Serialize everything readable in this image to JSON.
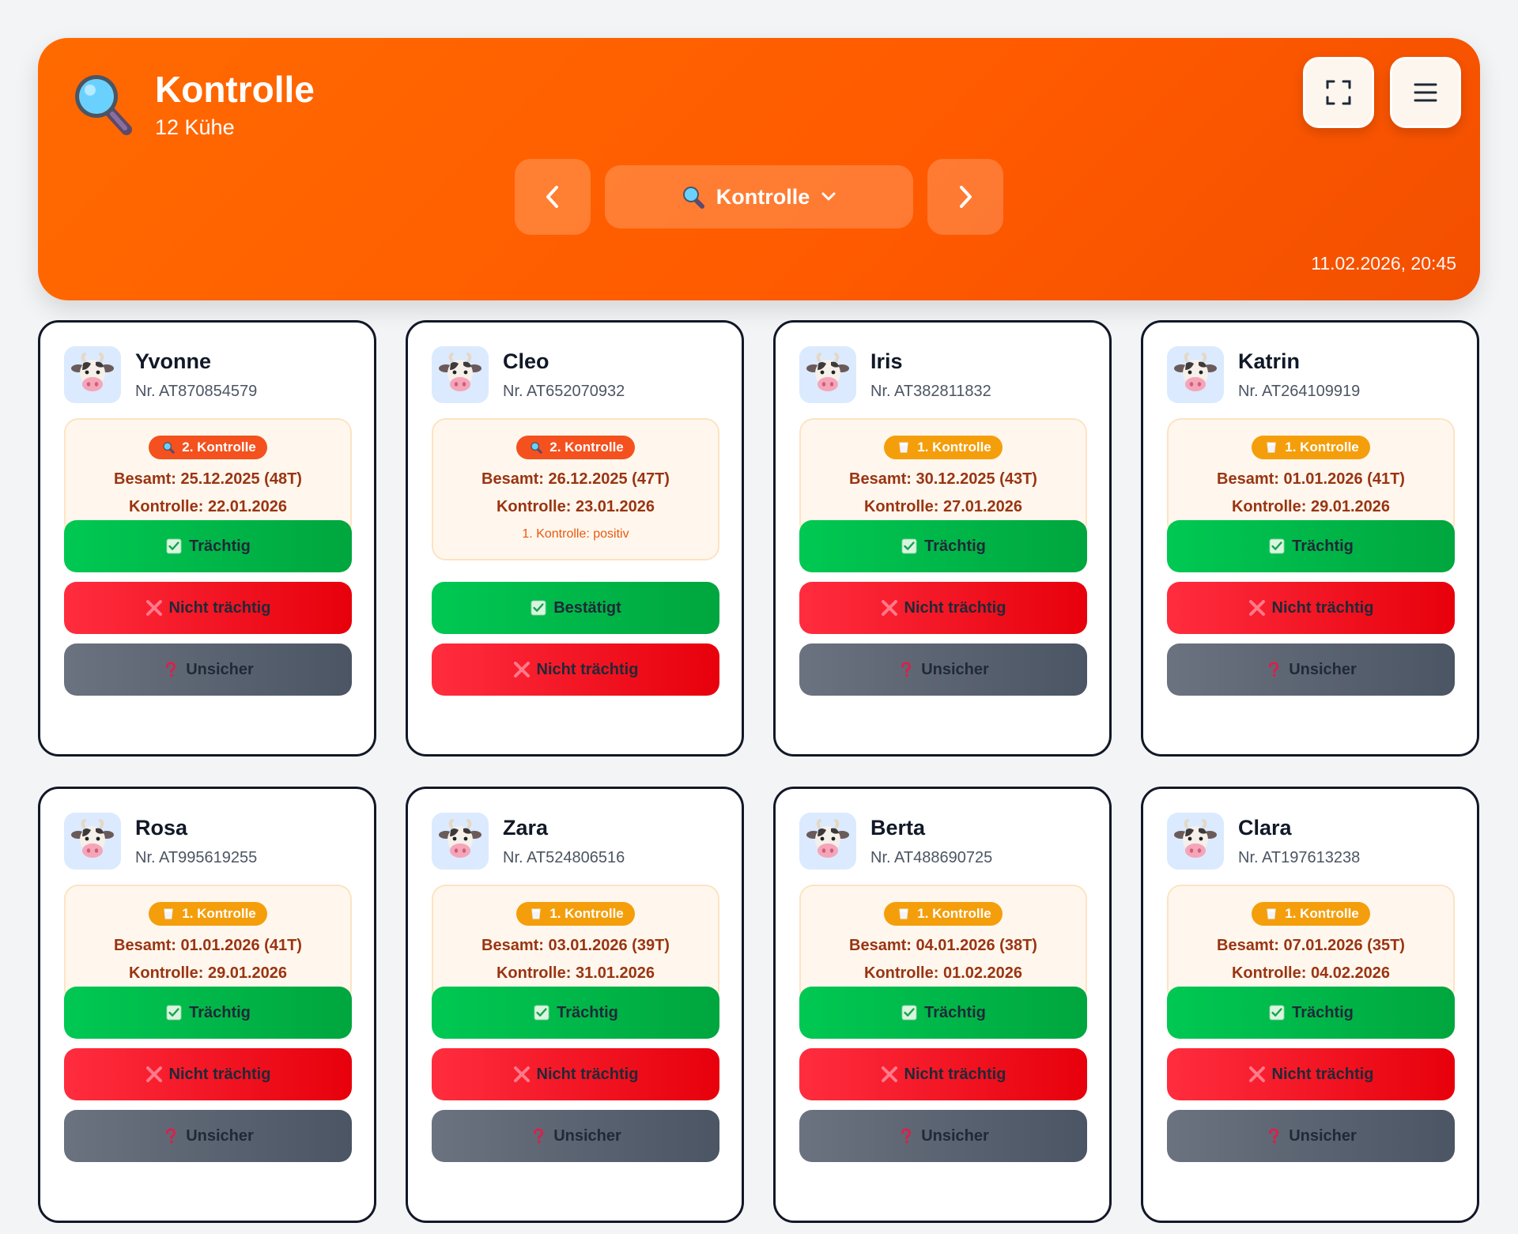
{
  "header": {
    "title": "Kontrolle",
    "subtitle": "12 Kühe",
    "nav_select_label": "Kontrolle",
    "datetime": "11.02.2026, 20:45",
    "brand_color": "#ff6a00"
  },
  "icons": {
    "header": "magnifying-glass-icon",
    "fullscreen": "fullscreen-icon",
    "menu": "hamburger-menu-icon",
    "prev": "chevron-left-icon",
    "next": "chevron-right-icon",
    "dropdown": "chevron-down-icon",
    "avatar": "cow-face-icon",
    "badge_k2": "magnifying-glass-icon",
    "badge_k1": "milk-glass-icon",
    "confirm": "check-box-icon",
    "reject": "cross-mark-icon",
    "unsure": "question-mark-icon"
  },
  "colors": {
    "green": "#00c853",
    "red": "#ff2d3f",
    "gray": "#6b7280",
    "badge_k2": "#f4511e",
    "badge_k1": "#f59e0b"
  },
  "cows": [
    {
      "name": "Yvonne",
      "nr": "Nr. AT870854579",
      "badge": "2. Kontrolle",
      "badge_type": "k2",
      "besamt": "Besamt: 25.12.2025 (48T)",
      "kontrolle": "Kontrolle: 22.01.2026",
      "note": "",
      "actions": [
        {
          "label": "Trächtig",
          "type": "green"
        },
        {
          "label": "Nicht trächtig",
          "type": "red"
        },
        {
          "label": "Unsicher",
          "type": "gray"
        }
      ]
    },
    {
      "name": "Cleo",
      "nr": "Nr. AT652070932",
      "badge": "2. Kontrolle",
      "badge_type": "k2",
      "besamt": "Besamt: 26.12.2025 (47T)",
      "kontrolle": "Kontrolle: 23.01.2026",
      "note": "1. Kontrolle: positiv",
      "actions": [
        {
          "label": "Bestätigt",
          "type": "green"
        },
        {
          "label": "Nicht trächtig",
          "type": "red"
        }
      ]
    },
    {
      "name": "Iris",
      "nr": "Nr. AT382811832",
      "badge": "1. Kontrolle",
      "badge_type": "k1",
      "besamt": "Besamt: 30.12.2025 (43T)",
      "kontrolle": "Kontrolle: 27.01.2026",
      "note": "",
      "actions": [
        {
          "label": "Trächtig",
          "type": "green"
        },
        {
          "label": "Nicht trächtig",
          "type": "red"
        },
        {
          "label": "Unsicher",
          "type": "gray"
        }
      ]
    },
    {
      "name": "Katrin",
      "nr": "Nr. AT264109919",
      "badge": "1. Kontrolle",
      "badge_type": "k1",
      "besamt": "Besamt: 01.01.2026 (41T)",
      "kontrolle": "Kontrolle: 29.01.2026",
      "note": "",
      "actions": [
        {
          "label": "Trächtig",
          "type": "green"
        },
        {
          "label": "Nicht trächtig",
          "type": "red"
        },
        {
          "label": "Unsicher",
          "type": "gray"
        }
      ]
    },
    {
      "name": "Rosa",
      "nr": "Nr. AT995619255",
      "badge": "1. Kontrolle",
      "badge_type": "k1",
      "besamt": "Besamt: 01.01.2026 (41T)",
      "kontrolle": "Kontrolle: 29.01.2026",
      "note": "",
      "actions": [
        {
          "label": "Trächtig",
          "type": "green"
        },
        {
          "label": "Nicht trächtig",
          "type": "red"
        },
        {
          "label": "Unsicher",
          "type": "gray"
        }
      ]
    },
    {
      "name": "Zara",
      "nr": "Nr. AT524806516",
      "badge": "1. Kontrolle",
      "badge_type": "k1",
      "besamt": "Besamt: 03.01.2026 (39T)",
      "kontrolle": "Kontrolle: 31.01.2026",
      "note": "",
      "actions": [
        {
          "label": "Trächtig",
          "type": "green"
        },
        {
          "label": "Nicht trächtig",
          "type": "red"
        },
        {
          "label": "Unsicher",
          "type": "gray"
        }
      ]
    },
    {
      "name": "Berta",
      "nr": "Nr. AT488690725",
      "badge": "1. Kontrolle",
      "badge_type": "k1",
      "besamt": "Besamt: 04.01.2026 (38T)",
      "kontrolle": "Kontrolle: 01.02.2026",
      "note": "",
      "actions": [
        {
          "label": "Trächtig",
          "type": "green"
        },
        {
          "label": "Nicht trächtig",
          "type": "red"
        },
        {
          "label": "Unsicher",
          "type": "gray"
        }
      ]
    },
    {
      "name": "Clara",
      "nr": "Nr. AT197613238",
      "badge": "1. Kontrolle",
      "badge_type": "k1",
      "besamt": "Besamt: 07.01.2026 (35T)",
      "kontrolle": "Kontrolle: 04.02.2026",
      "note": "",
      "actions": [
        {
          "label": "Trächtig",
          "type": "green"
        },
        {
          "label": "Nicht trächtig",
          "type": "red"
        },
        {
          "label": "Unsicher",
          "type": "gray"
        }
      ]
    }
  ]
}
